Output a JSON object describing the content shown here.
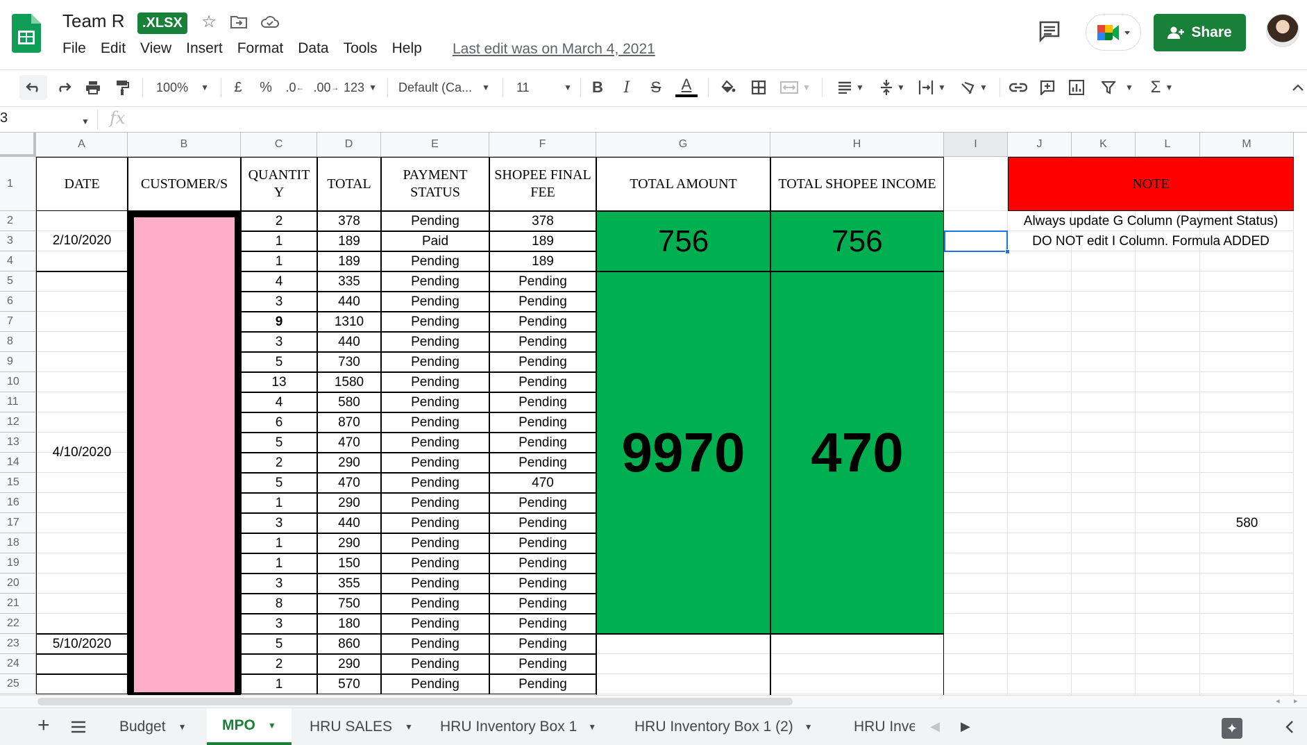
{
  "document": {
    "title": "Team R",
    "format_badge": ".XLSX",
    "last_edit": "Last edit was on March 4, 2021",
    "menu": [
      "File",
      "Edit",
      "View",
      "Insert",
      "Format",
      "Data",
      "Tools",
      "Help"
    ],
    "share_label": "Share",
    "icons": [
      "star-icon",
      "move-folder-icon",
      "cloud-status-icon",
      "comments-icon",
      "meet-icon",
      "avatar"
    ]
  },
  "toolbar": {
    "zoom": "100%",
    "currency": "£",
    "percent": "%",
    "decrease_decimals": ".0",
    "increase_decimals": ".00",
    "more_formats": "123",
    "font": "Default (Ca...",
    "font_size": "11",
    "bold": "B",
    "italic": "I",
    "strike": "S",
    "text_color": "A"
  },
  "formula_bar": {
    "name_box": "3",
    "fx": "fx",
    "content": ""
  },
  "columns": [
    "A",
    "B",
    "C",
    "D",
    "E",
    "F",
    "G",
    "H",
    "I",
    "J",
    "K",
    "L",
    "M"
  ],
  "rows": [
    "1",
    "2",
    "3",
    "4",
    "5",
    "6",
    "7",
    "8",
    "9",
    "10",
    "11",
    "12",
    "13",
    "14",
    "15",
    "16",
    "17",
    "18",
    "19",
    "20",
    "21",
    "22",
    "23",
    "24",
    "25"
  ],
  "headers": {
    "date": "DATE",
    "customer": "CUSTOMER/S",
    "quantity": "QUANTIT Y",
    "total": "TOTAL",
    "payment_status": "PAYMENT STATUS",
    "shopee_final_fee": "SHOPEE FINAL FEE",
    "total_amount": "TOTAL AMOUNT",
    "total_shopee_income": "TOTAL SHOPEE INCOME",
    "note": "NOTE"
  },
  "dates": [
    "2/10/2020",
    "4/10/2020",
    "5/10/2020"
  ],
  "table_rows": [
    {
      "qty": "2",
      "total": "378",
      "status": "Pending",
      "fee": "378"
    },
    {
      "qty": "1",
      "total": "189",
      "status": "Paid",
      "fee": "189"
    },
    {
      "qty": "1",
      "total": "189",
      "status": "Pending",
      "fee": "189"
    },
    {
      "qty": "4",
      "total": "335",
      "status": "Pending",
      "fee": "Pending"
    },
    {
      "qty": "3",
      "total": "440",
      "status": "Pending",
      "fee": "Pending"
    },
    {
      "qty": "9",
      "total": "1310",
      "status": "Pending",
      "fee": "Pending"
    },
    {
      "qty": "3",
      "total": "440",
      "status": "Pending",
      "fee": "Pending"
    },
    {
      "qty": "5",
      "total": "730",
      "status": "Pending",
      "fee": "Pending"
    },
    {
      "qty": "13",
      "total": "1580",
      "status": "Pending",
      "fee": "Pending"
    },
    {
      "qty": "4",
      "total": "580",
      "status": "Pending",
      "fee": "Pending"
    },
    {
      "qty": "6",
      "total": "870",
      "status": "Pending",
      "fee": "Pending"
    },
    {
      "qty": "5",
      "total": "470",
      "status": "Pending",
      "fee": "Pending"
    },
    {
      "qty": "2",
      "total": "290",
      "status": "Pending",
      "fee": "Pending"
    },
    {
      "qty": "5",
      "total": "470",
      "status": "Pending",
      "fee": "470"
    },
    {
      "qty": "1",
      "total": "290",
      "status": "Pending",
      "fee": "Pending"
    },
    {
      "qty": "3",
      "total": "440",
      "status": "Pending",
      "fee": "Pending"
    },
    {
      "qty": "1",
      "total": "290",
      "status": "Pending",
      "fee": "Pending"
    },
    {
      "qty": "1",
      "total": "150",
      "status": "Pending",
      "fee": "Pending"
    },
    {
      "qty": "3",
      "total": "355",
      "status": "Pending",
      "fee": "Pending"
    },
    {
      "qty": "8",
      "total": "750",
      "status": "Pending",
      "fee": "Pending"
    },
    {
      "qty": "3",
      "total": "180",
      "status": "Pending",
      "fee": "Pending"
    },
    {
      "qty": "5",
      "total": "860",
      "status": "Pending",
      "fee": "Pending"
    },
    {
      "qty": "2",
      "total": "290",
      "status": "Pending",
      "fee": "Pending"
    },
    {
      "qty": "1",
      "total": "570",
      "status": "Pending",
      "fee": "Pending"
    }
  ],
  "summary": {
    "g_small": "756",
    "h_small": "756",
    "g_big": "9970",
    "h_big": "470"
  },
  "notes": {
    "line1": "Always update G Column (Payment Status)",
    "line2": "DO NOT edit I Column. Formula ADDED",
    "m17": "580"
  },
  "sheet_tabs": [
    "Budget",
    "MPO",
    "HRU SALES",
    "HRU Inventory Box 1",
    "HRU Inventory Box 1 (2)",
    "HRU Inve"
  ],
  "active_tab": "MPO",
  "colors": {
    "green_fill": "#00b050",
    "red_fill": "#ff0000",
    "pink_fill": "#ffadc8",
    "brand_green": "#188038"
  }
}
